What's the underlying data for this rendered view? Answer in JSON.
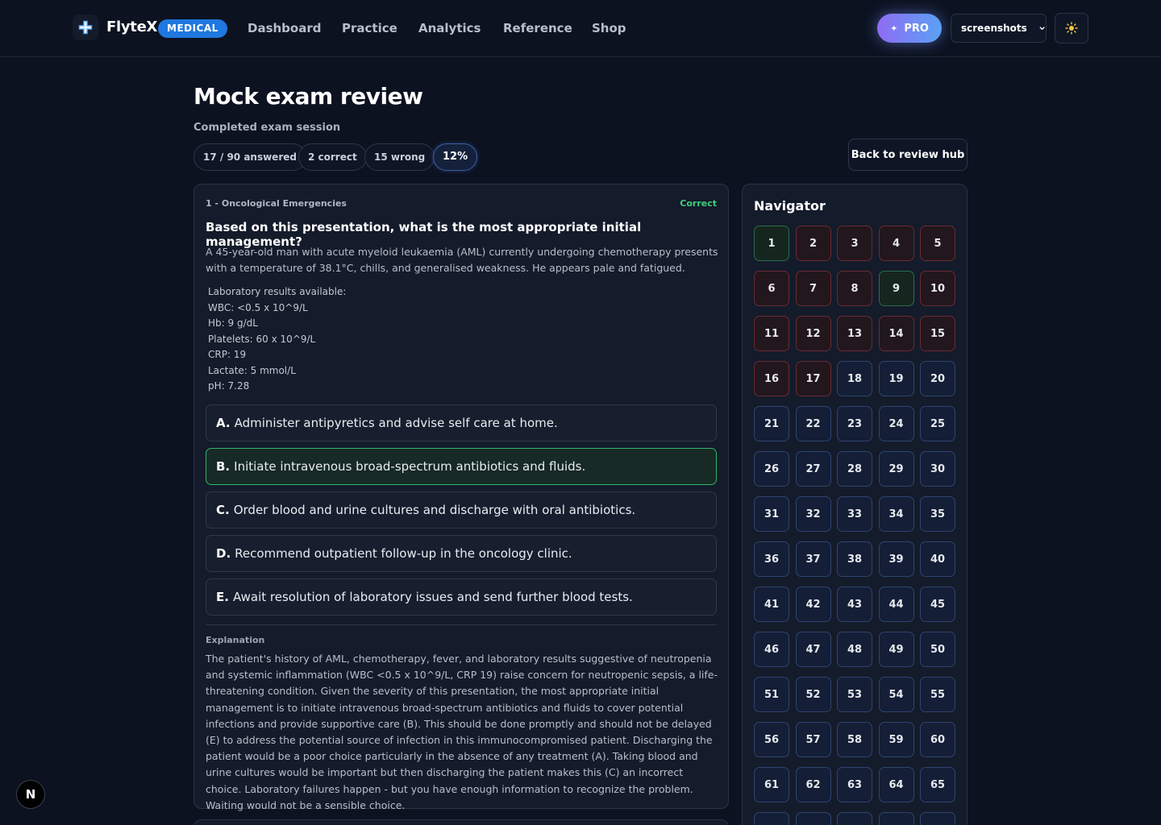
{
  "header": {
    "brand": "FlyteX",
    "badge": "MEDICAL",
    "nav": [
      "Dashboard",
      "Practice",
      "Analytics",
      "Reference",
      "Shop"
    ],
    "pro_label": "PRO",
    "user": "screenshots"
  },
  "page": {
    "title": "Mock exam review",
    "subtitle": "Completed exam session",
    "stats": [
      "17 / 90 answered",
      "2 correct",
      "15 wrong",
      "12%"
    ],
    "back_label": "Back to review hub"
  },
  "question": {
    "topic": "1 - Oncological Emergencies",
    "status": "Correct",
    "title": "Based on this presentation, what is the most appropriate initial management?",
    "stem": "A 45-year-old man with acute myeloid leukaemia (AML) currently undergoing chemotherapy presents with a temperature of 38.1°C, chills, and generalised weakness. He appears pale and fatigued.",
    "labs": [
      "Laboratory results available:",
      "WBC: <0.5 x 10^9/L",
      "Hb: 9 g/dL",
      "Platelets: 60 x 10^9/L",
      "CRP: 19",
      "Lactate: 5 mmol/L",
      "pH: 7.28"
    ],
    "options": [
      {
        "letter": "A.",
        "text": "Administer antipyretics and advise self care at home."
      },
      {
        "letter": "B.",
        "text": "Initiate intravenous broad-spectrum antibiotics and fluids."
      },
      {
        "letter": "C.",
        "text": "Order blood and urine cultures and discharge with oral antibiotics."
      },
      {
        "letter": "D.",
        "text": "Recommend outpatient follow-up in the oncology clinic."
      },
      {
        "letter": "E.",
        "text": "Await resolution of laboratory issues and send further blood tests."
      }
    ],
    "correct_option": "B.",
    "explanation_label": "Explanation",
    "explanation": "The patient's history of AML, chemotherapy, fever, and laboratory results suggestive of neutropenia and systemic inflammation (WBC <0.5 x 10^9/L, CRP 19) raise concern for neutropenic sepsis, a life-threatening condition. Given the severity of this presentation, the most appropriate initial management is to initiate intravenous broad-spectrum antibiotics and fluids to cover potential infections and provide supportive care (B). This should be done promptly and should not be delayed (E) to address the potential source of infection in this immunocompromised patient. Discharging the patient would be a poor choice particularly in the absence of any treatment (A). Taking blood and urine cultures would be important but then discharging the patient makes this (C) an incorrect choice. Laboratory failures happen - but you have enough information to recognize the problem. Waiting would not be a sensible choice."
  },
  "navigator": {
    "title": "Navigator",
    "total_shown": 70,
    "correct": [
      1,
      9
    ],
    "wrong": [
      2,
      3,
      4,
      5,
      6,
      7,
      8,
      10,
      11,
      12,
      13,
      14,
      15,
      16,
      17
    ]
  },
  "dev_badge": "N",
  "colors": {
    "background": "#0c1220",
    "accent_blue": "#1f78e0",
    "correct_green": "#3fcf7d",
    "wrong_red": "#6b2a33"
  }
}
